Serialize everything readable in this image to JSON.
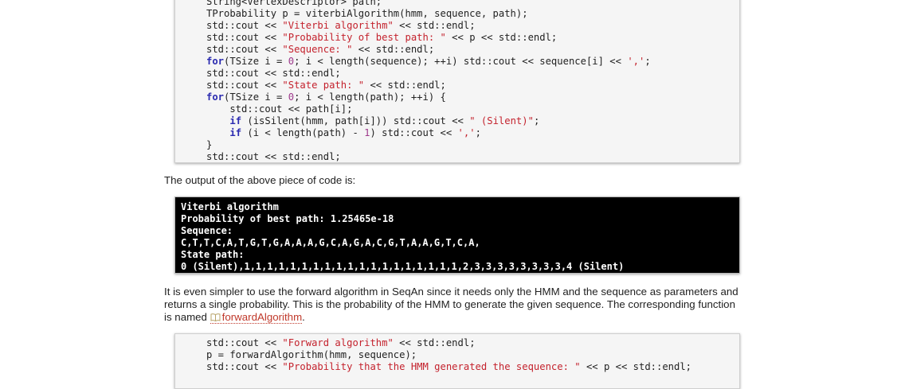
{
  "code_block_1": {
    "lines": [
      [
        {
          "t": "String<VertexDescriptor> path;",
          "c": ""
        }
      ],
      [
        {
          "t": "TProbability p = viterbiAlgorithm(hmm, sequence, path);",
          "c": ""
        }
      ],
      [
        {
          "t": "std::cout << ",
          "c": ""
        },
        {
          "t": "\"Viterbi algorithm\"",
          "c": "str"
        },
        {
          "t": " << std::endl;",
          "c": ""
        }
      ],
      [
        {
          "t": "std::cout << ",
          "c": ""
        },
        {
          "t": "\"Probability of best path: \"",
          "c": "str"
        },
        {
          "t": " << p << std::endl;",
          "c": ""
        }
      ],
      [
        {
          "t": "std::cout << ",
          "c": ""
        },
        {
          "t": "\"Sequence: \"",
          "c": "str"
        },
        {
          "t": " << std::endl;",
          "c": ""
        }
      ],
      [
        {
          "t": "for",
          "c": "kw"
        },
        {
          "t": "(TSize i = ",
          "c": ""
        },
        {
          "t": "0",
          "c": "nm"
        },
        {
          "t": "; i < length(sequence); ++i) std::cout << sequence[i] << ",
          "c": ""
        },
        {
          "t": "','",
          "c": "str"
        },
        {
          "t": ";",
          "c": ""
        }
      ],
      [
        {
          "t": "std::cout << std::endl;",
          "c": ""
        }
      ],
      [
        {
          "t": "std::cout << ",
          "c": ""
        },
        {
          "t": "\"State path: \"",
          "c": "str"
        },
        {
          "t": " << std::endl;",
          "c": ""
        }
      ],
      [
        {
          "t": "for",
          "c": "kw"
        },
        {
          "t": "(TSize i = ",
          "c": ""
        },
        {
          "t": "0",
          "c": "nm"
        },
        {
          "t": "; i < length(path); ++i) {",
          "c": ""
        }
      ],
      [
        {
          "t": "    std::cout << path[i];",
          "c": ""
        }
      ],
      [
        {
          "t": "    ",
          "c": ""
        },
        {
          "t": "if",
          "c": "kw"
        },
        {
          "t": " (isSilent(hmm, path[i])) std::cout << ",
          "c": ""
        },
        {
          "t": "\" (Silent)\"",
          "c": "str"
        },
        {
          "t": ";",
          "c": ""
        }
      ],
      [
        {
          "t": "    ",
          "c": ""
        },
        {
          "t": "if",
          "c": "kw"
        },
        {
          "t": " (i < length(path) - ",
          "c": ""
        },
        {
          "t": "1",
          "c": "nm"
        },
        {
          "t": ") std::cout << ",
          "c": ""
        },
        {
          "t": "','",
          "c": "str"
        },
        {
          "t": ";",
          "c": ""
        }
      ],
      [
        {
          "t": "}",
          "c": ""
        }
      ],
      [
        {
          "t": "std::cout << std::endl;",
          "c": ""
        }
      ]
    ]
  },
  "text_output_intro": "The output of the above piece of code is:",
  "output_block": {
    "lines": [
      "Viterbi algorithm",
      "Probability of best path: 1.25465e-18",
      "Sequence:",
      "C,T,T,C,A,T,G,T,G,A,A,A,G,C,A,G,A,C,G,T,A,A,G,T,C,A,",
      "State path:",
      "0 (Silent),1,1,1,1,1,1,1,1,1,1,1,1,1,1,1,1,1,1,1,2,3,3,3,3,3,3,3,3,4 (Silent)"
    ]
  },
  "paragraph_forward": {
    "text": "It is even simpler to use the forward algorithm in SeqAn since it needs only the HMM and the sequence as parameters and returns a single probability. This is the probability of the HMM to generate the given sequence. The corresponding function is named ",
    "link_label": "forwardAlgorithm",
    "link_icon": "book-icon",
    "tail": "."
  },
  "code_block_2": {
    "lines": [
      [
        {
          "t": "std::cout << ",
          "c": ""
        },
        {
          "t": "\"Forward algorithm\"",
          "c": "str"
        },
        {
          "t": " << std::endl;",
          "c": ""
        }
      ],
      [
        {
          "t": "p = forwardAlgorithm(hmm, sequence);",
          "c": ""
        }
      ],
      [
        {
          "t": "std::cout << ",
          "c": ""
        },
        {
          "t": "\"Probability that the HMM generated the sequence: \"",
          "c": "str"
        },
        {
          "t": " << p << std::endl;",
          "c": ""
        }
      ]
    ]
  },
  "colors": {
    "keyword": "#2a2ab0",
    "string": "#c4222d",
    "number": "#9e3a8c",
    "link": "#c0392b",
    "output_bg": "#000000"
  }
}
